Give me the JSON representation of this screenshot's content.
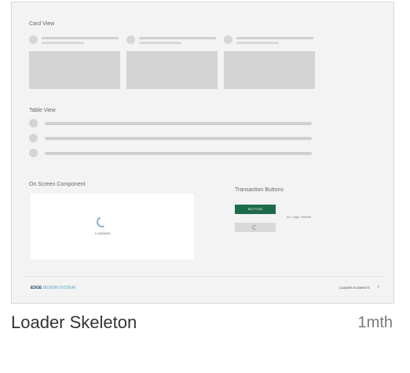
{
  "thumbnail": {
    "card_view_label": "Card View",
    "table_view_label": "Table View",
    "onscreen_label": "On Screen Component",
    "loading_label": "LOADING",
    "transaction_label": "Transaction Buttons",
    "button_label": "BUTTON",
    "hint": "ex: Login, Submit",
    "brand_bold": "EDGE",
    "brand_light": "DESIGN SYSTEM",
    "footer_right": "LOADER ELEMENTS",
    "colors": {
      "primary_button": "#1e6b4a",
      "brand_dark": "#1a3a5c",
      "brand_light": "#4aa0c0",
      "chevron": "#2f7fc1"
    }
  },
  "item": {
    "title": "Loader Skeleton",
    "time": "1mth"
  }
}
